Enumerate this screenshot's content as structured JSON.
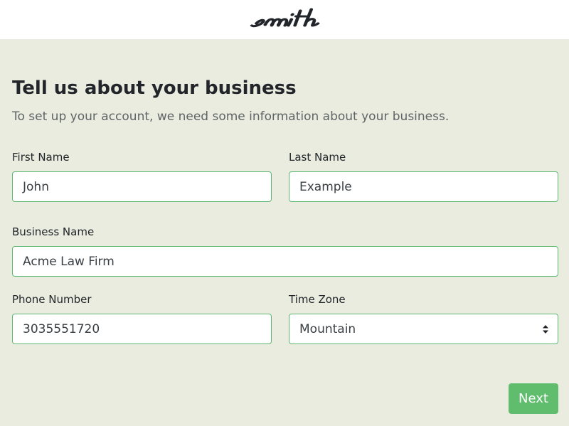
{
  "header": {
    "logo_text": "smith"
  },
  "form": {
    "title": "Tell us about your business",
    "subtitle": "To set up your account, we need some information about your business.",
    "first_name": {
      "label": "First Name",
      "value": "John"
    },
    "last_name": {
      "label": "Last Name",
      "value": "Example"
    },
    "business_name": {
      "label": "Business Name",
      "value": "Acme Law Firm"
    },
    "phone_number": {
      "label": "Phone Number",
      "value": "3035551720"
    },
    "time_zone": {
      "label": "Time Zone",
      "value": "Mountain"
    },
    "next_label": "Next"
  },
  "colors": {
    "accent": "#5fbd6d",
    "background": "#e9ecdf",
    "field_border": "#5cb870"
  }
}
